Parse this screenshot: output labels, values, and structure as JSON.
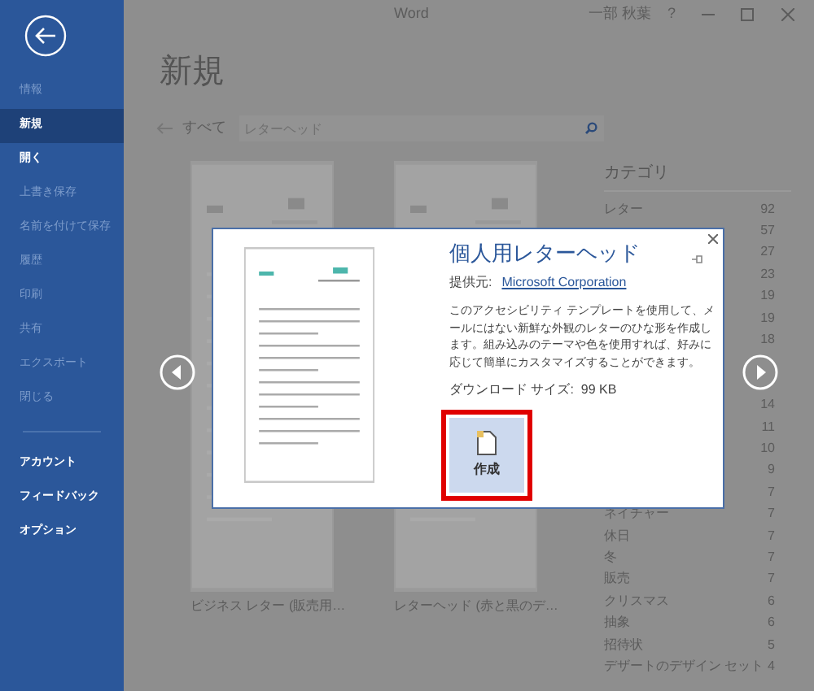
{
  "sidebar": {
    "items": [
      {
        "label": "情報",
        "selected": false,
        "disabled": true
      },
      {
        "label": "新規",
        "selected": true,
        "disabled": false
      },
      {
        "label": "開く",
        "selected": false,
        "disabled": false
      },
      {
        "label": "上書き保存",
        "selected": false,
        "disabled": true
      },
      {
        "label": "名前を付けて保存",
        "selected": false,
        "disabled": true
      },
      {
        "label": "履歴",
        "selected": false,
        "disabled": true
      },
      {
        "label": "印刷",
        "selected": false,
        "disabled": true
      },
      {
        "label": "共有",
        "selected": false,
        "disabled": true
      },
      {
        "label": "エクスポート",
        "selected": false,
        "disabled": true
      },
      {
        "label": "閉じる",
        "selected": false,
        "disabled": true
      }
    ],
    "bottom_items": [
      {
        "label": "アカウント"
      },
      {
        "label": "フィードバック"
      },
      {
        "label": "オプション"
      }
    ]
  },
  "titlebar": {
    "title": "Word",
    "user": "一部 秋葉",
    "help": "?"
  },
  "heading": "新規",
  "search": {
    "breadcrumb": "すべて",
    "value": "レターヘッド"
  },
  "templates": [
    {
      "label": "ビジネス レター (販売用…"
    },
    {
      "label": "レターヘッド (赤と黒のデ…"
    }
  ],
  "categories": {
    "title": "カテゴリ",
    "rows": [
      {
        "name": "レター",
        "count": "92"
      },
      {
        "count": "57"
      },
      {
        "count": "27"
      },
      {
        "count": "23"
      },
      {
        "count": "19"
      },
      {
        "count": "19"
      },
      {
        "count": "18"
      }
    ],
    "more_rows": [
      {
        "count": "14"
      },
      {
        "count": "11"
      },
      {
        "count": "10"
      },
      {
        "count": "9"
      },
      {
        "count": "7"
      },
      {
        "name": "ネイチャー",
        "count": "7"
      },
      {
        "name": "休日",
        "count": "7"
      },
      {
        "name": "冬",
        "count": "7"
      },
      {
        "name": "販売",
        "count": "7"
      },
      {
        "name": "クリスマス",
        "count": "6"
      },
      {
        "name": "抽象",
        "count": "6"
      },
      {
        "name": "招待状",
        "count": "5"
      },
      {
        "name": "デザートのデザイン セット",
        "count": "4"
      }
    ]
  },
  "dialog": {
    "title": "個人用レターヘッド",
    "provider_label": "提供元:",
    "provider": "Microsoft Corporation",
    "description": "このアクセシビリティ テンプレートを使用して、メールにはない新鮮な外観のレターのひな形を作成します。組み込みのテーマや色を使用すれば、好みに応じて簡単にカスタマイズすることができます。",
    "download": "ダウンロード サイズ:  99 KB",
    "create": "作成"
  }
}
